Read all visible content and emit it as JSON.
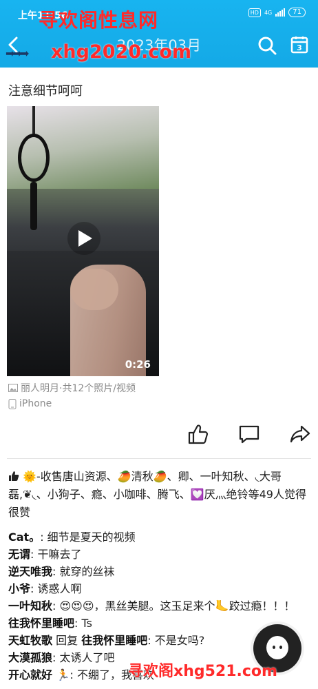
{
  "status_bar": {
    "time": "上午11:56",
    "hd": "HD",
    "network": "4G",
    "battery": "71"
  },
  "header": {
    "title": "2023年03月",
    "watermark_top": "寻欢阁性息网",
    "watermark_url": "xhg2020.com"
  },
  "post": {
    "text": "注意细节呵呵",
    "video_duration": "0:26",
    "album": "丽人明月·共12个照片/视频",
    "device": "iPhone"
  },
  "likes": {
    "text": "-收售唐山资源、🥭清秋🥭、卿、一叶知秋、◟大哥磊,❦◟、小狗子、瘾、小咖啡、腾飞、💟厌灬绝铃等49人觉得很赞"
  },
  "comments": [
    {
      "author": "Cat。",
      "text": ": 细节是夏天的视频"
    },
    {
      "author": "无谓",
      "text": ": 干嘛去了"
    },
    {
      "author": "逆天唯我",
      "text": ": 就穿的丝袜"
    },
    {
      "author": "小爷",
      "text": ": 诱惑人啊"
    },
    {
      "author": "一叶知秋",
      "text": ": 😍😍😍，黑丝美腿。这玉足来个🦶跤过瘾！！！"
    },
    {
      "author": "往我怀里睡吧",
      "text": ": Ts"
    },
    {
      "author": "天虹牧歌",
      "reply_word": " 回复 ",
      "reply_to": "往我怀里睡吧",
      "text": ": 不是女吗?"
    },
    {
      "author": "大漠孤狼",
      "text": ": 太诱人了吧"
    },
    {
      "author": "开心就好 🏃",
      "text": ": 不绷了，我喜欢"
    }
  ],
  "watermark_bottom": "寻欢阁xhg521.com",
  "colors": {
    "header_blue": "#16aeea",
    "watermark_red": "#ff2a2a"
  }
}
